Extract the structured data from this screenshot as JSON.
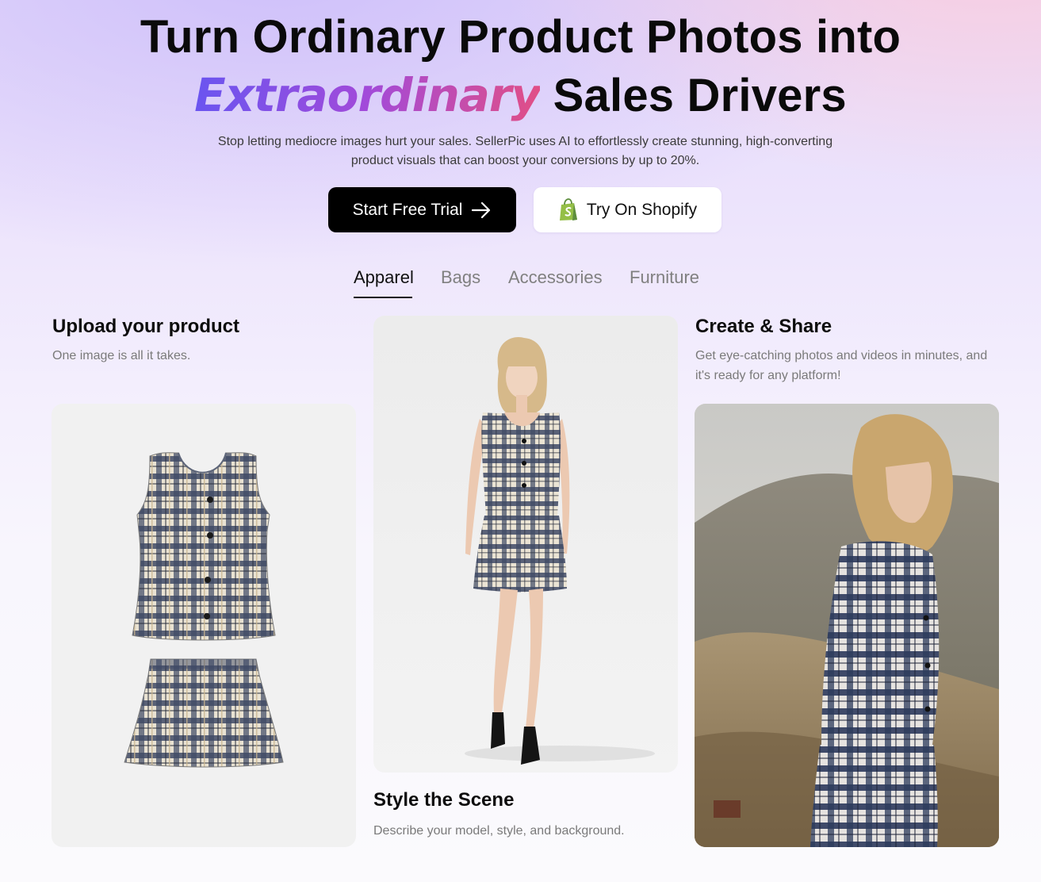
{
  "hero": {
    "title_line1": "Turn Ordinary Product Photos into",
    "title_accent": "Extraordinary",
    "title_line2_rest": "Sales Drivers",
    "subtitle": "Stop letting mediocre images hurt your sales. SellerPic uses AI to effortlessly create stunning, high-converting product visuals that can boost your conversions by up to 20%."
  },
  "buttons": {
    "primary_label": "Start Free Trial",
    "primary_icon": "arrow-right-icon",
    "secondary_label": "Try On Shopify",
    "secondary_icon": "shopify-bag-icon"
  },
  "tabs": [
    {
      "label": "Apparel",
      "active": true
    },
    {
      "label": "Bags",
      "active": false
    },
    {
      "label": "Accessories",
      "active": false
    },
    {
      "label": "Furniture",
      "active": false
    }
  ],
  "steps": {
    "upload": {
      "title": "Upload your product",
      "desc": "One image is all it takes."
    },
    "style": {
      "title": "Style the Scene",
      "desc": "Describe your model, style, and background."
    },
    "create": {
      "title": "Create & Share",
      "desc": "Get eye-catching photos and videos in minutes, and it's ready for any platform!"
    }
  },
  "colors": {
    "accent_start": "#6a55f0",
    "accent_mid": "#a24ad9",
    "accent_end": "#e14f86",
    "primary_button": "#000000",
    "shopify_green": "#95bf47"
  }
}
